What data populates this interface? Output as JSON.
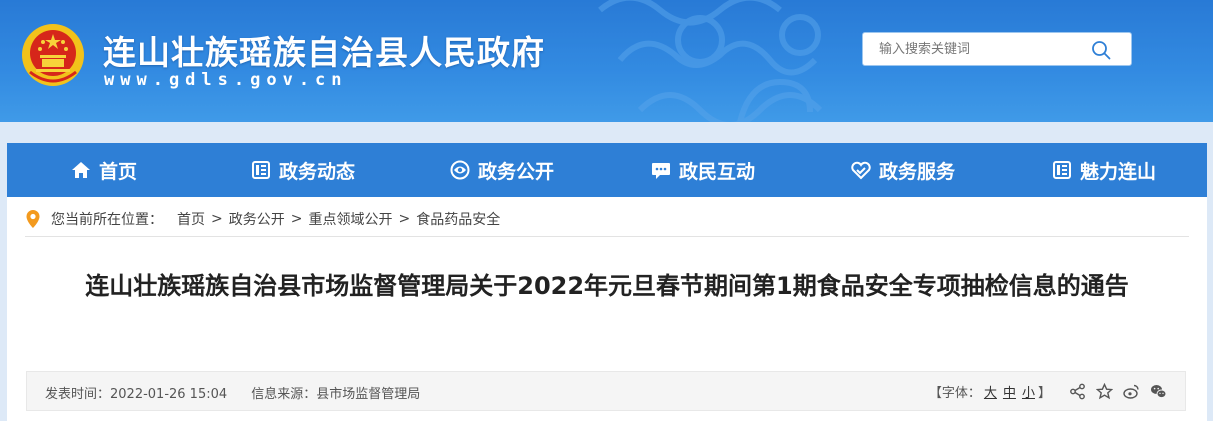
{
  "header": {
    "site_title": "连山壮族瑶族自治县人民政府",
    "site_domain": "www.gdls.gov.cn",
    "search_placeholder": "输入搜索关键词"
  },
  "nav": {
    "items": [
      {
        "label": "首页",
        "icon": "home-icon"
      },
      {
        "label": "政务动态",
        "icon": "news-icon"
      },
      {
        "label": "政务公开",
        "icon": "eye-icon"
      },
      {
        "label": "政民互动",
        "icon": "chat-icon"
      },
      {
        "label": "政务服务",
        "icon": "handshake-icon"
      },
      {
        "label": "魅力连山",
        "icon": "document-icon"
      }
    ]
  },
  "breadcrumb": {
    "label": "您当前所在位置：",
    "items": [
      "首页",
      "政务公开",
      "重点领域公开",
      "食品药品安全"
    ],
    "separator": ">"
  },
  "article": {
    "title": "连山壮族瑶族自治县市场监督管理局关于2022年元旦春节期间第1期食品安全专项抽检信息的通告",
    "meta": {
      "publish_time": "发表时间：2022-01-26 15:04",
      "source": "信息来源：县市场监督管理局",
      "font_label": "【字体：",
      "font_large": "大",
      "font_medium": "中",
      "font_small": "小",
      "font_end": "】"
    }
  },
  "colors": {
    "header_blue": "#2b86e0",
    "nav_blue": "#2e7fd6",
    "pin_orange": "#f39a1e"
  }
}
